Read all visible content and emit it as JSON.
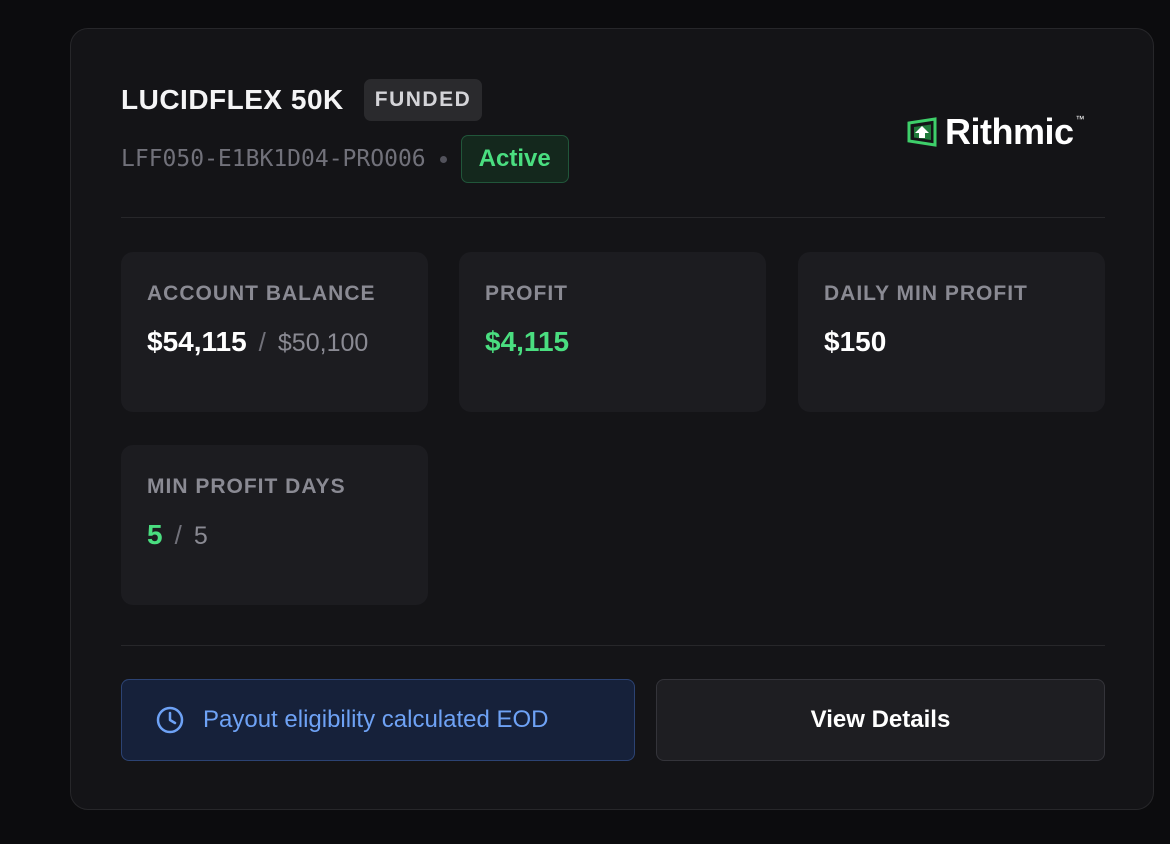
{
  "account": {
    "name": "LUCIDFLEX 50K",
    "type_badge": "FUNDED",
    "id": "LFF050-E1BK1D04-PRO006",
    "status": "Active"
  },
  "provider": {
    "name": "Rithmic",
    "trademark": "™",
    "icon": "rithmic-logo-icon"
  },
  "stats": {
    "balance": {
      "label": "ACCOUNT BALANCE",
      "value": "$54,115",
      "separator": "/",
      "target": "$50,100"
    },
    "profit": {
      "label": "PROFIT",
      "value": "$4,115"
    },
    "daily_min_profit": {
      "label": "DAILY MIN PROFIT",
      "value": "$150"
    },
    "min_profit_days": {
      "label": "MIN PROFIT DAYS",
      "value": "5",
      "separator": "/",
      "target": "5"
    }
  },
  "payout": {
    "icon": "clock-icon",
    "text": "Payout eligibility calculated EOD"
  },
  "actions": {
    "view_details": "View Details"
  },
  "colors": {
    "accent_green": "#4ade80",
    "accent_blue": "#6ea2f5",
    "card_bg": "#141417",
    "page_bg": "#0c0c0e"
  }
}
